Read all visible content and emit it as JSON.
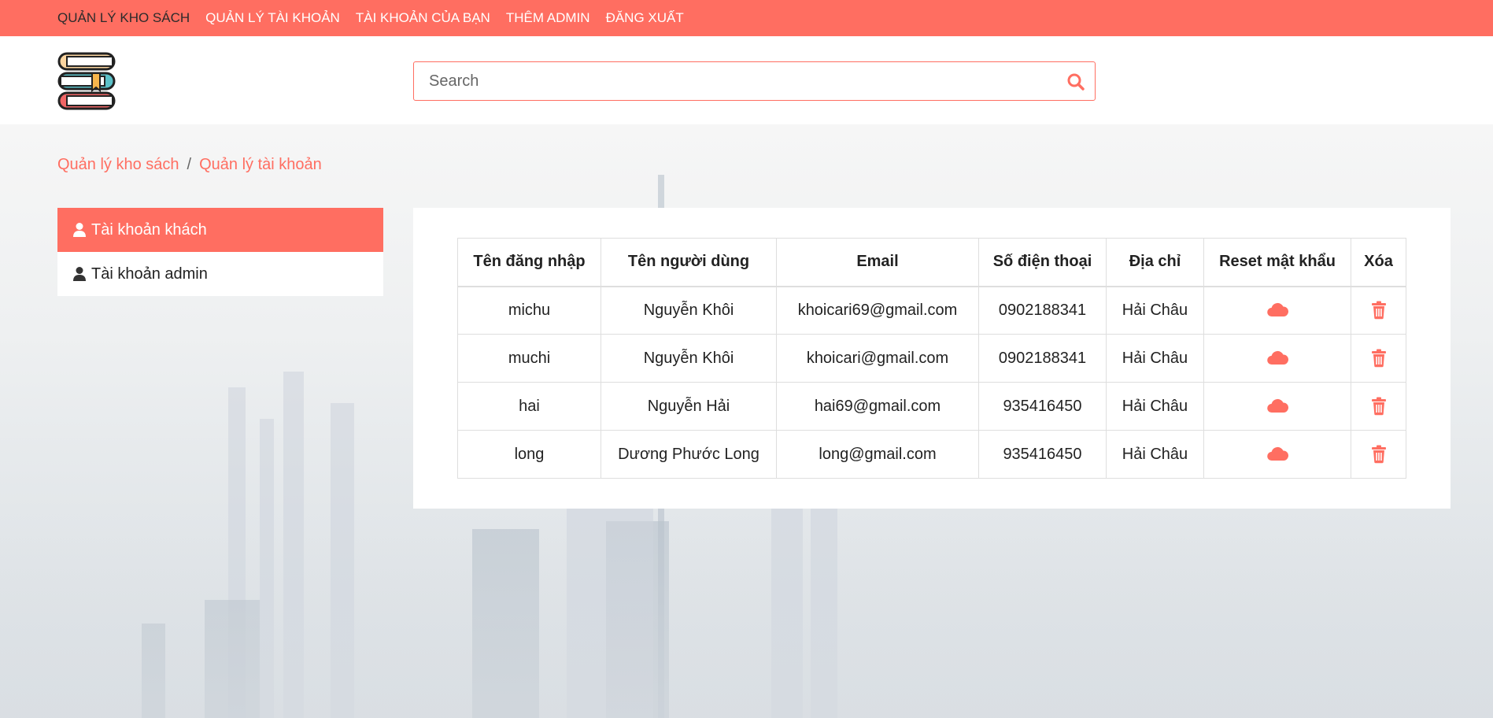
{
  "nav": {
    "items": [
      {
        "label": "QUẢN LÝ KHO SÁCH",
        "active": true
      },
      {
        "label": "QUẢN LÝ TÀI KHOẢN",
        "active": false
      },
      {
        "label": "TÀI KHOẢN CỦA BẠN",
        "active": false
      },
      {
        "label": "THÊM ADMIN",
        "active": false
      },
      {
        "label": "ĐĂNG XUẤT",
        "active": false
      }
    ]
  },
  "search": {
    "placeholder": "Search",
    "value": ""
  },
  "breadcrumb": {
    "items": [
      "Quản lý kho sách",
      "Quản lý tài khoản"
    ],
    "separator": "/"
  },
  "sidebar": {
    "items": [
      {
        "label": "Tài khoản khách",
        "icon": "user-icon",
        "active": true
      },
      {
        "label": "Tài khoản admin",
        "icon": "user-icon",
        "active": false
      }
    ]
  },
  "table": {
    "headers": [
      "Tên đăng nhập",
      "Tên người dùng",
      "Email",
      "Số điện thoại",
      "Địa chỉ",
      "Reset mật khẩu",
      "Xóa"
    ],
    "rows": [
      {
        "username": "michu",
        "fullname": "Nguyễn Khôi",
        "email": "khoicari69@gmail.com",
        "phone": "0902188341",
        "address": "Hải Châu"
      },
      {
        "username": "muchi",
        "fullname": "Nguyễn Khôi",
        "email": "khoicari@gmail.com",
        "phone": "0902188341",
        "address": "Hải Châu"
      },
      {
        "username": "hai",
        "fullname": "Nguyễn Hải",
        "email": "hai69@gmail.com",
        "phone": "935416450",
        "address": "Hải Châu"
      },
      {
        "username": "long",
        "fullname": "Dương Phước Long",
        "email": "long@gmail.com",
        "phone": "935416450",
        "address": "Hải Châu"
      }
    ],
    "reset_icon": "cloud-icon",
    "delete_icon": "trash-icon"
  },
  "colors": {
    "accent": "#ff6e61",
    "nav_active_text": "#2b2b2b"
  }
}
